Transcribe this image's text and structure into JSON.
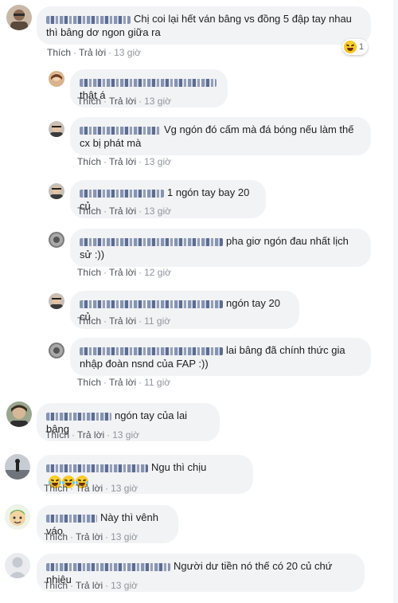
{
  "actions": {
    "like": "Thích",
    "reply": "Trả lời",
    "sep": "·"
  },
  "comments": [
    {
      "text": "Chị coi lại hết ván bâng vs đồng 5 đập tay nhau thì bâng dơ ngon giữa ra",
      "time": "13 giờ",
      "reaction_count": "1"
    },
    {
      "text": "thật á",
      "time": "13 giờ"
    },
    {
      "text": "Vg ngón đó cấm mà đá bóng nếu làm thế cx bị phát mà",
      "time": "13 giờ"
    },
    {
      "text": "1 ngón tay bay 20 củ",
      "time": "13 giờ"
    },
    {
      "text": "pha giơ ngón đau nhất lịch sử :))",
      "time": "12 giờ"
    },
    {
      "text": "ngón tay 20 củ",
      "time": "11 giờ"
    },
    {
      "text": "lai bâng đã chính thức gia nhập đoàn nsnd của FAP :))",
      "time": "11 giờ"
    },
    {
      "text": "ngón tay của lai bâng",
      "time": "13 giờ"
    },
    {
      "text": "Ngu thì chịu",
      "time": "13 giờ"
    },
    {
      "text": "Này thì vênh váo",
      "time": "13 giờ"
    },
    {
      "text": "Người dư tiền nó thế có 20 củ chứ nhiêu",
      "time": "13 giờ"
    }
  ],
  "colors": {
    "bubble": "#f2f3f5",
    "link": "#4b4f56",
    "time": "#90949c"
  },
  "icons": {
    "reaction": "laughing-emoji-icon"
  }
}
